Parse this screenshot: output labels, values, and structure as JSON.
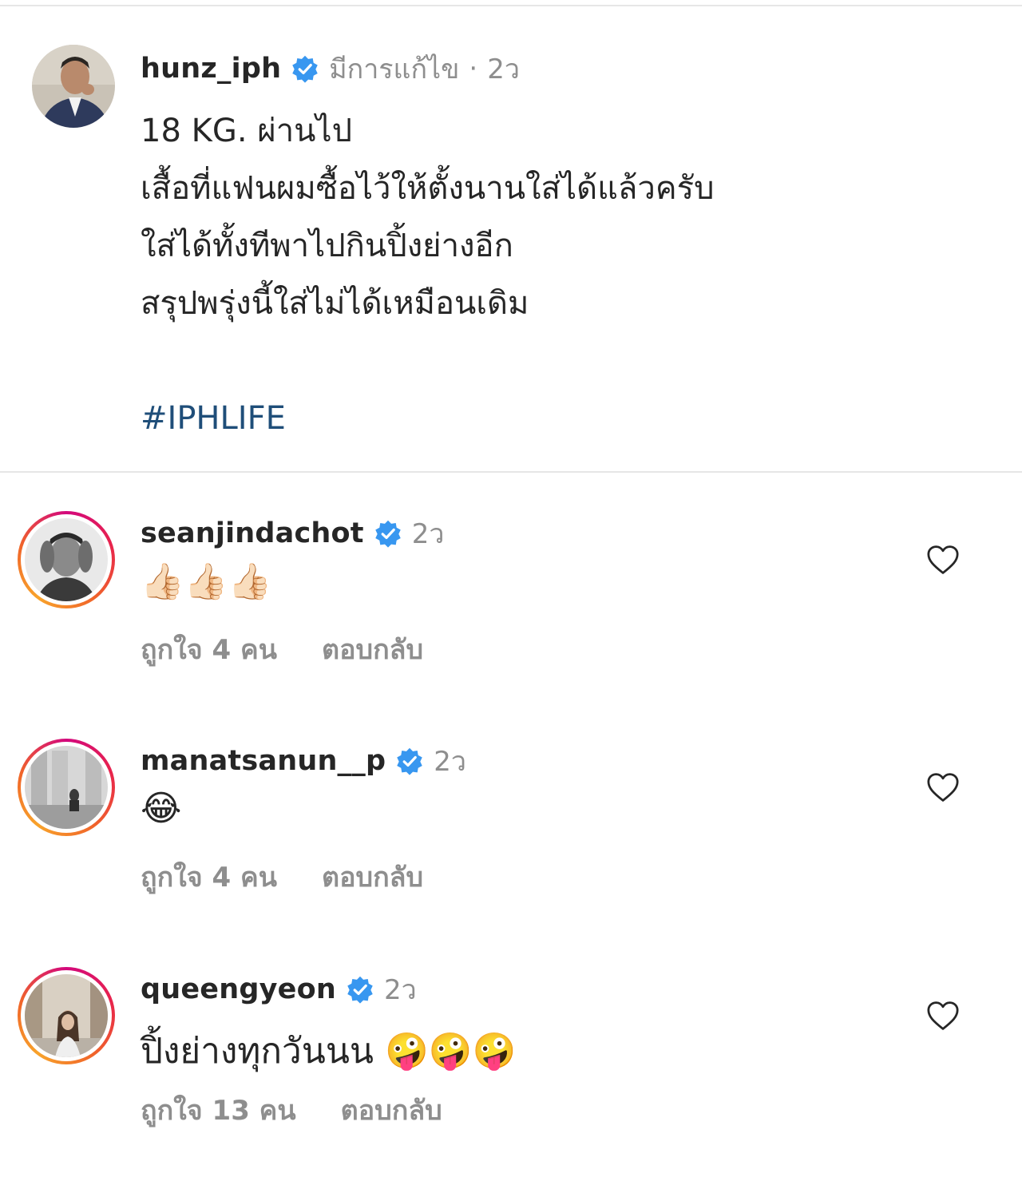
{
  "post": {
    "username": "hunz_iph",
    "edited_label": "มีการแก้ไข",
    "separator": "·",
    "time": "2ว",
    "caption_lines": [
      "18 KG. ผ่านไป",
      "เสื้อที่แฟนผมซื้อไว้ให้ตั้งนานใส่ได้แล้วครับ",
      "ใส่ได้ทั้งทีพาไปกินปิ้งย่างอีก",
      "สรุปพรุ่งนี้ใส่ไม่ได้เหมือนเดิม"
    ],
    "hashtag": "#IPHLIFE"
  },
  "comments": [
    {
      "username": "seanjindachot",
      "time": "2ว",
      "text": "👍🏻👍🏻👍🏻",
      "likes": "ถูกใจ 4 คน",
      "reply": "ตอบกลับ"
    },
    {
      "username": "manatsanun__p",
      "time": "2ว",
      "text": "😂",
      "likes": "ถูกใจ 4 คน",
      "reply": "ตอบกลับ"
    },
    {
      "username": "queengyeon",
      "time": "2ว",
      "text": "ปิ้งย่างทุกวันนน 🤪🤪🤪",
      "likes": "ถูกใจ 13 คน",
      "reply": "ตอบกลับ"
    }
  ],
  "icons": {
    "verified": "verified-badge-icon",
    "heart": "heart-outline-icon"
  },
  "colors": {
    "verified_blue": "#3897f0",
    "hashtag": "#1f4e79",
    "meta_gray": "#8e8e8e",
    "text": "#262626"
  }
}
